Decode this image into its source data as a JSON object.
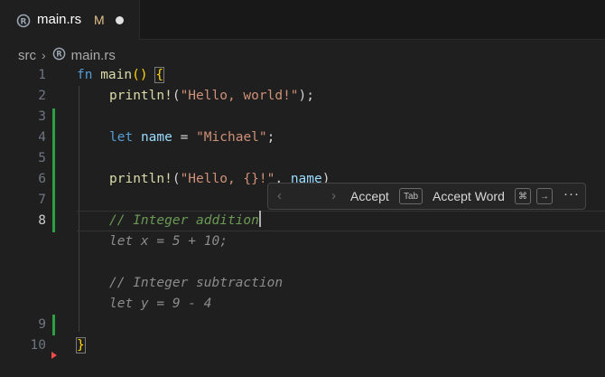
{
  "tab": {
    "filename": "main.rs",
    "status": "M"
  },
  "breadcrumb": {
    "folder": "src",
    "file": "main.rs"
  },
  "lines": {
    "n1": "1",
    "n2": "2",
    "n3": "3",
    "n4": "4",
    "n5": "5",
    "n6": "6",
    "n7": "7",
    "n8": "8",
    "n9": "9",
    "n10": "10",
    "l1_kw": "fn",
    "l1_fn": "main",
    "l1_paren": "()",
    "l1_brace": "{",
    "l2_macro": "println!",
    "l2_open": "(",
    "l2_str": "\"Hello, world!\"",
    "l2_close": ");",
    "l4_kw": "let",
    "l4_var": "name",
    "l4_eq": " = ",
    "l4_str": "\"Michael\"",
    "l4_semi": ";",
    "l6_macro": "println!",
    "l6_open": "(",
    "l6_str": "\"Hello, {}!\"",
    "l6_comma": ", ",
    "l6_var": "name",
    "l6_close": ")",
    "l8_comment": "// Integer addition",
    "ghost1": "let x = 5 + 10;",
    "ghost2": "// Integer subtraction",
    "ghost3": "let y = 9 - 4",
    "l10_brace": "}"
  },
  "suggest": {
    "prev": "‹",
    "next": "›",
    "accept_label": "Accept",
    "accept_key": "Tab",
    "accept_word_label": "Accept Word",
    "key_cmd": "⌘",
    "key_arrow": "→",
    "more": "···"
  },
  "colors": {
    "added_gutter": "#2ea043",
    "error_marker": "#f14c4c",
    "modified": "#e2c08d"
  }
}
